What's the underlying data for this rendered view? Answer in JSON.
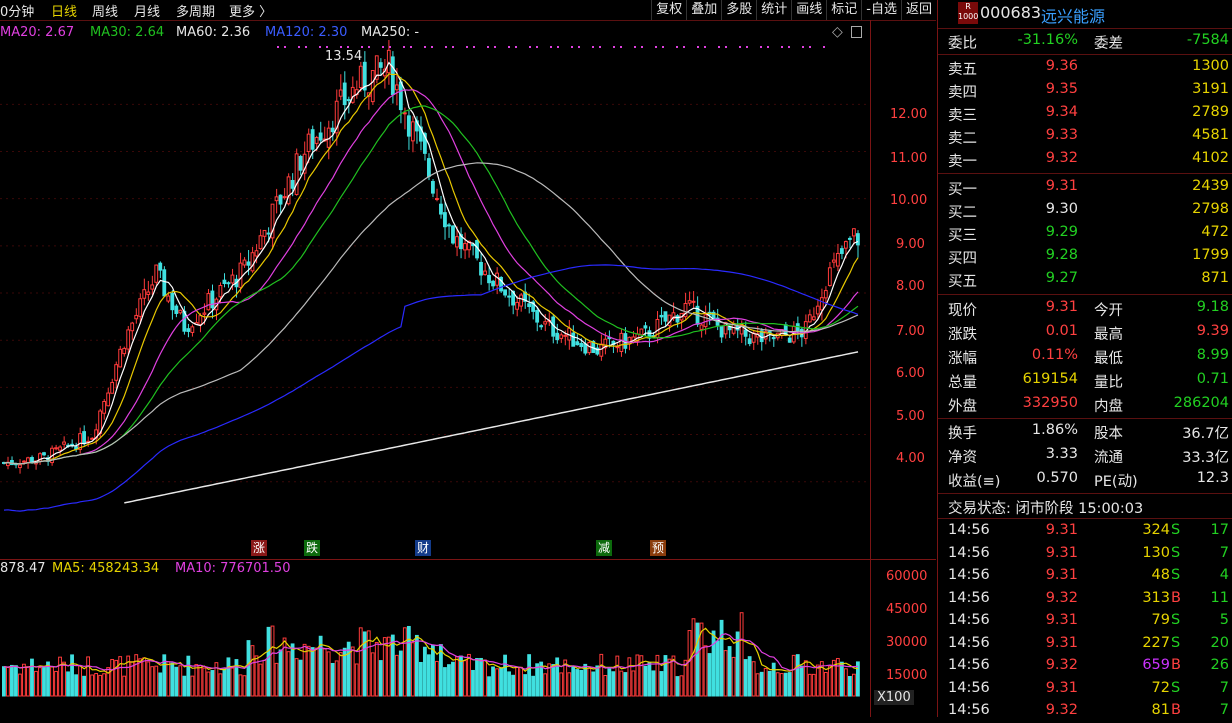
{
  "toolbar": {
    "left_tabs": [
      "0分钟",
      "日线",
      "周线",
      "月线",
      "多周期",
      "更多 〉"
    ],
    "right_buttons": [
      "复权",
      "叠加",
      "多股",
      "统计",
      "画线",
      "标记",
      "-自选",
      "返回"
    ]
  },
  "ma_legend": {
    "ma20": "MA20: 2.67",
    "ma30": "MA30: 2.64",
    "ma60": "MA60: 2.36",
    "ma120": "MA120: 2.30",
    "ma250": "MA250: -"
  },
  "price_chart": {
    "high_label": "13.54",
    "y_ticks": [
      "12.00",
      "11.00",
      "10.00",
      "9.00",
      "8.00",
      "7.00",
      "6.00",
      "5.00",
      "4.00"
    ],
    "events": [
      {
        "label": "涨",
        "color": "#c02020"
      },
      {
        "label": "跌",
        "color": "#10a010"
      },
      {
        "label": "财",
        "color": "#1d5fd0"
      },
      {
        "label": "减",
        "color": "#10a010"
      },
      {
        "label": "预",
        "color": "#d06010"
      }
    ],
    "colors": {
      "up": "#ff3b3b",
      "down": "#40e0e0",
      "ma5": "#ffffff",
      "ma10": "#e8c800",
      "ma20": "#e040e0",
      "ma30": "#20c020",
      "ma60": "#bbbbbb",
      "ma120": "#2a2aff",
      "ma250": "#e8e8e8"
    }
  },
  "volume_chart": {
    "legend_vol": "878.47",
    "legend_ma5": "MA5: 458243.34",
    "legend_ma10": "MA10: 776701.50",
    "y_ticks": [
      "60000",
      "45000",
      "30000",
      "15000"
    ],
    "unit": "X100"
  },
  "stock": {
    "badge_top": "R",
    "badge_bottom": "1000",
    "code": "000683",
    "name": "远兴能源"
  },
  "order_book": {
    "weibi_label": "委比",
    "weibi_value": "-31.16%",
    "weicha_label": "委差",
    "weicha_value": "-7584",
    "asks": [
      {
        "label": "卖五",
        "price": "9.36",
        "vol": "1300"
      },
      {
        "label": "卖四",
        "price": "9.35",
        "vol": "3191"
      },
      {
        "label": "卖三",
        "price": "9.34",
        "vol": "2789"
      },
      {
        "label": "卖二",
        "price": "9.33",
        "vol": "4581"
      },
      {
        "label": "卖一",
        "price": "9.32",
        "vol": "4102"
      }
    ],
    "bids": [
      {
        "label": "买一",
        "price": "9.31",
        "vol": "2439",
        "pcolor": "red"
      },
      {
        "label": "买二",
        "price": "9.30",
        "vol": "2798",
        "pcolor": "white"
      },
      {
        "label": "买三",
        "price": "9.29",
        "vol": "472",
        "pcolor": "green"
      },
      {
        "label": "买四",
        "price": "9.28",
        "vol": "1799",
        "pcolor": "green"
      },
      {
        "label": "买五",
        "price": "9.27",
        "vol": "871",
        "pcolor": "green"
      }
    ]
  },
  "quote": {
    "rows": [
      {
        "l1": "现价",
        "v1": "9.31",
        "c1": "red",
        "l2": "今开",
        "v2": "9.18",
        "c2": "green"
      },
      {
        "l1": "涨跌",
        "v1": "0.01",
        "c1": "red",
        "l2": "最高",
        "v2": "9.39",
        "c2": "red"
      },
      {
        "l1": "涨幅",
        "v1": "0.11%",
        "c1": "red",
        "l2": "最低",
        "v2": "8.99",
        "c2": "green"
      },
      {
        "l1": "总量",
        "v1": "619154",
        "c1": "yellow",
        "l2": "量比",
        "v2": "0.71",
        "c2": "green"
      },
      {
        "l1": "外盘",
        "v1": "332950",
        "c1": "red",
        "l2": "内盘",
        "v2": "286204",
        "c2": "green"
      }
    ],
    "rows2": [
      {
        "l1": "换手",
        "v1": "1.86%",
        "l2": "股本",
        "v2": "36.7亿"
      },
      {
        "l1": "净资",
        "v1": "3.33",
        "l2": "流通",
        "v2": "33.3亿"
      },
      {
        "l1": "收益(≡)",
        "v1": "0.570",
        "l2": "PE(动)",
        "v2": "12.3"
      }
    ]
  },
  "trade_status": "交易状态: 闭市阶段 15:00:03",
  "ticks": [
    {
      "time": "14:56",
      "price": "9.31",
      "vol": "324",
      "vcolor": "yellow",
      "side": "S",
      "n": "17"
    },
    {
      "time": "14:56",
      "price": "9.31",
      "vol": "130",
      "vcolor": "yellow",
      "side": "S",
      "n": "7"
    },
    {
      "time": "14:56",
      "price": "9.31",
      "vol": "48",
      "vcolor": "yellow",
      "side": "S",
      "n": "4"
    },
    {
      "time": "14:56",
      "price": "9.32",
      "vol": "313",
      "vcolor": "yellow",
      "side": "B",
      "n": "11"
    },
    {
      "time": "14:56",
      "price": "9.31",
      "vol": "79",
      "vcolor": "yellow",
      "side": "S",
      "n": "5"
    },
    {
      "time": "14:56",
      "price": "9.31",
      "vol": "227",
      "vcolor": "yellow",
      "side": "S",
      "n": "20"
    },
    {
      "time": "14:56",
      "price": "9.32",
      "vol": "659",
      "vcolor": "purple",
      "side": "B",
      "n": "26"
    },
    {
      "time": "14:56",
      "price": "9.31",
      "vol": "72",
      "vcolor": "yellow",
      "side": "S",
      "n": "7"
    },
    {
      "time": "14:56",
      "price": "9.32",
      "vol": "81",
      "vcolor": "yellow",
      "side": "B",
      "n": "7"
    }
  ]
}
